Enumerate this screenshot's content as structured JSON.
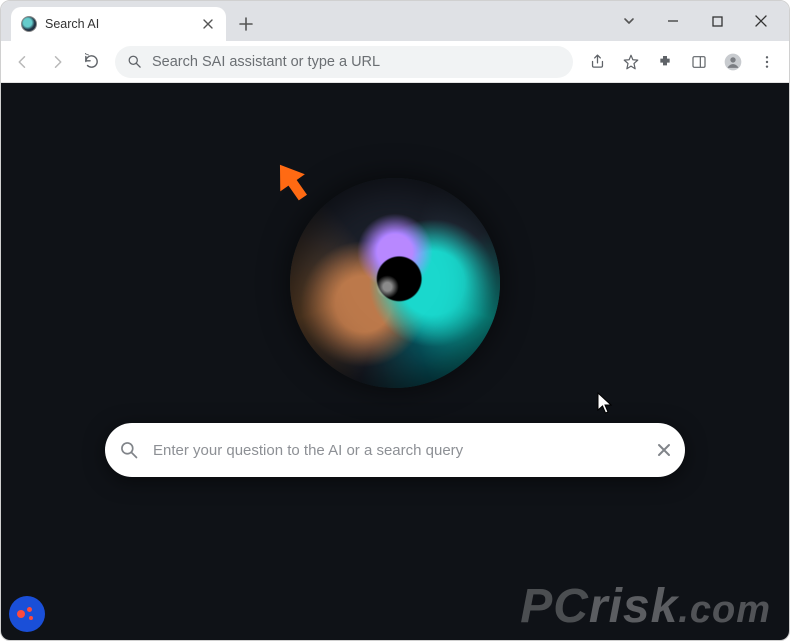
{
  "window": {
    "tab_title": "Search AI"
  },
  "omnibox": {
    "placeholder": "Search SAI assistant or type a URL",
    "value": ""
  },
  "page": {
    "search_placeholder": "Enter your question to the AI or a search query",
    "search_value": ""
  },
  "watermark": {
    "prefix": "PC",
    "body": "risk",
    "tld": ".com"
  }
}
